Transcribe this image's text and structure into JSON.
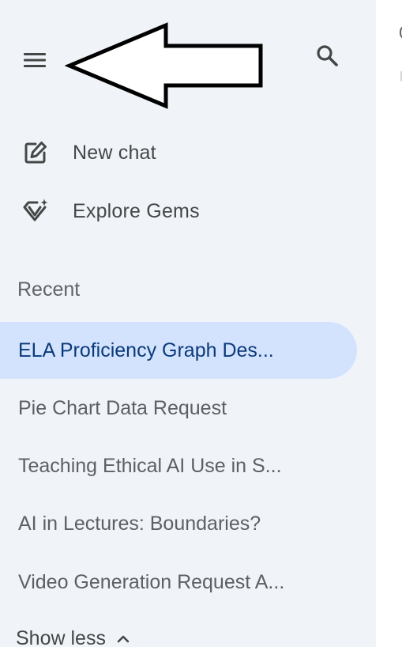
{
  "sidebar": {
    "menu_icon": "hamburger-menu-icon",
    "search_icon": "search-icon",
    "nav": [
      {
        "label": "New chat",
        "icon": "edit-square-icon"
      },
      {
        "label": "Explore Gems",
        "icon": "gem-sparkle-icon"
      }
    ],
    "recent_heading": "Recent",
    "recent": [
      {
        "label": "ELA Proficiency Graph Des...",
        "active": true
      },
      {
        "label": "Pie Chart Data Request",
        "active": false
      },
      {
        "label": "Teaching Ethical AI Use in S...",
        "active": false
      },
      {
        "label": "AI in Lectures: Boundaries?",
        "active": false
      },
      {
        "label": "Video Generation Request A...",
        "active": false
      }
    ],
    "show_less_label": "Show less",
    "show_less_icon": "chevron-up-icon"
  },
  "annotation": {
    "icon": "left-arrow-annotation-icon"
  },
  "colors": {
    "sidebar_bg": "#f0f4f9",
    "active_bg": "#d3e3fd",
    "active_text": "#0b3a7a",
    "text": "#444746"
  }
}
